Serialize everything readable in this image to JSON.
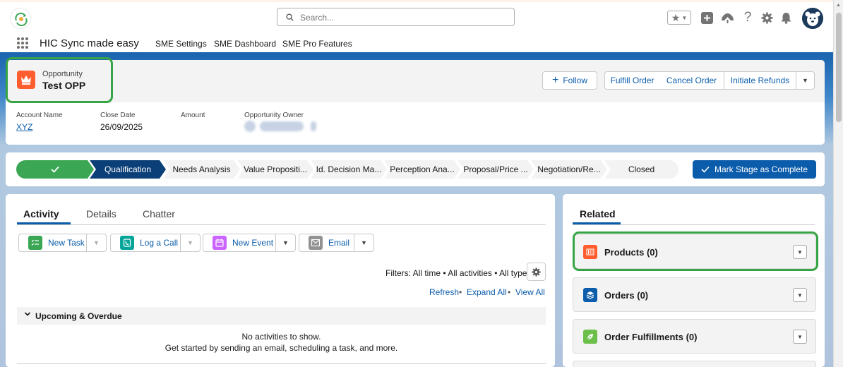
{
  "header": {
    "search_placeholder": "Search...",
    "icons": [
      "favorites-star-icon",
      "add-icon",
      "trailhead-icon",
      "help-icon",
      "setup-gear-icon",
      "notifications-bell-icon"
    ]
  },
  "nav": {
    "app_name": "HIC Sync made easy",
    "items": [
      {
        "label": "SME Settings"
      },
      {
        "label": "SME Dashboard"
      },
      {
        "label": "SME Pro Features"
      }
    ]
  },
  "record": {
    "type": "Opportunity",
    "name": "Test OPP",
    "actions": {
      "follow": "Follow",
      "fulfill": "Fulfill Order",
      "cancel": "Cancel Order",
      "refunds": "Initiate Refunds"
    },
    "fields": {
      "account_label": "Account Name",
      "account_value": "XYZ",
      "close_label": "Close Date",
      "close_value": "26/09/2025",
      "amount_label": "Amount",
      "owner_label": "Opportunity Owner"
    }
  },
  "path": {
    "stages": [
      {
        "label": "",
        "state": "done"
      },
      {
        "label": "Qualification",
        "state": "current"
      },
      {
        "label": "Needs Analysis",
        "state": "upcoming"
      },
      {
        "label": "Value Propositi...",
        "state": "upcoming"
      },
      {
        "label": "Id. Decision Ma...",
        "state": "upcoming"
      },
      {
        "label": "Perception Ana...",
        "state": "upcoming"
      },
      {
        "label": "Proposal/Price ...",
        "state": "upcoming"
      },
      {
        "label": "Negotiation/Re...",
        "state": "upcoming"
      },
      {
        "label": "Closed",
        "state": "upcoming"
      }
    ],
    "mark_complete": "Mark Stage as Complete"
  },
  "activity": {
    "tabs": [
      {
        "label": "Activity"
      },
      {
        "label": "Details"
      },
      {
        "label": "Chatter"
      }
    ],
    "quick_actions": {
      "new_task": "New Task",
      "log_call": "Log a Call",
      "new_event": "New Event",
      "email": "Email"
    },
    "filters": "Filters: All time • All activities • All types",
    "links": {
      "refresh": "Refresh",
      "expand_all": "Expand All",
      "view_all": "View All",
      "separator": "•"
    },
    "upcoming_title": "Upcoming & Overdue",
    "no_activities": "No activities to show.",
    "get_started": "Get started by sending an email, scheduling a task, and more."
  },
  "related": {
    "tab": "Related",
    "items": [
      {
        "label": "Products (0)"
      },
      {
        "label": "Orders (0)"
      },
      {
        "label": "Order Fulfillments (0)"
      }
    ]
  },
  "colors": {
    "brand_blue": "#0b5cab",
    "path_done": "#3ba755",
    "path_current": "#0b3f77",
    "highlight_green": "#36a444",
    "opportunity_icon": "#ff5d2d"
  }
}
